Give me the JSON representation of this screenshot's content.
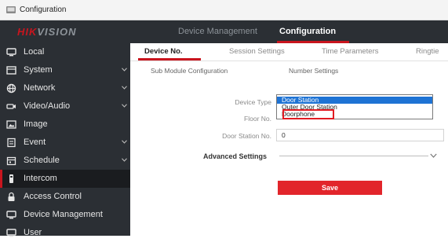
{
  "window": {
    "title": "Configuration"
  },
  "header": {
    "logo": {
      "red_part": "HIK",
      "rest": "VISION"
    },
    "nav": [
      "Device Management",
      "Configuration"
    ],
    "active_nav": "Configuration"
  },
  "sidebar": {
    "items": [
      {
        "label": "Local",
        "icon": "monitor-icon",
        "has_chevron": false
      },
      {
        "label": "System",
        "icon": "system-icon",
        "has_chevron": true
      },
      {
        "label": "Network",
        "icon": "globe-icon",
        "has_chevron": true
      },
      {
        "label": "Video/Audio",
        "icon": "camera-icon",
        "has_chevron": true
      },
      {
        "label": "Image",
        "icon": "image-icon",
        "has_chevron": false
      },
      {
        "label": "Event",
        "icon": "event-icon",
        "has_chevron": true
      },
      {
        "label": "Schedule",
        "icon": "calendar-icon",
        "has_chevron": true
      },
      {
        "label": "Intercom",
        "icon": "intercom-icon",
        "has_chevron": false,
        "active": true
      },
      {
        "label": "Access Control",
        "icon": "lock-icon",
        "has_chevron": false
      },
      {
        "label": "Device Management",
        "icon": "monitor-icon",
        "has_chevron": false
      },
      {
        "label": "User",
        "icon": "monitor-icon",
        "has_chevron": false
      }
    ]
  },
  "main": {
    "tabs": [
      "Device No.",
      "Session Settings",
      "Time Parameters",
      "Ringtie"
    ],
    "active_tab": "Device No.",
    "subtabs": [
      "Sub Module Configuration",
      "Number Settings"
    ],
    "form": {
      "device_type_label": "Device Type",
      "device_type_options": [
        "Door Station",
        "Outer Door Station",
        "Doorphone"
      ],
      "device_type_selected": "Door Station",
      "floor_no_label": "Floor No.",
      "door_station_no_label": "Door Station No.",
      "door_station_no_value": "0"
    },
    "advanced_label": "Advanced Settings",
    "save_label": "Save"
  },
  "colors": {
    "accent": "#c9151e",
    "save_button": "#e2252b",
    "sidebar_bg": "#2b2f34",
    "selection": "#1e73d4"
  }
}
